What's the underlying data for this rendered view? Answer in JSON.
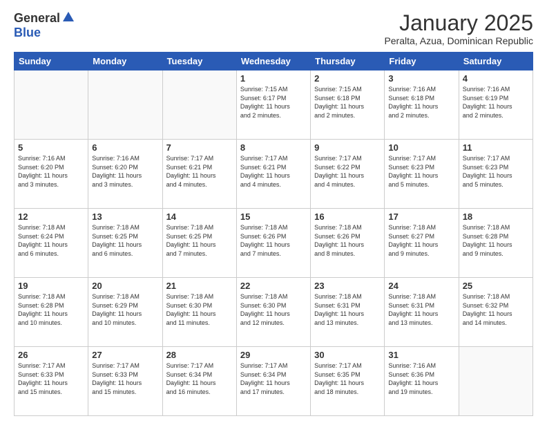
{
  "header": {
    "logo_general": "General",
    "logo_blue": "Blue",
    "title": "January 2025",
    "subtitle": "Peralta, Azua, Dominican Republic"
  },
  "weekdays": [
    "Sunday",
    "Monday",
    "Tuesday",
    "Wednesday",
    "Thursday",
    "Friday",
    "Saturday"
  ],
  "weeks": [
    [
      {
        "day": "",
        "info": ""
      },
      {
        "day": "",
        "info": ""
      },
      {
        "day": "",
        "info": ""
      },
      {
        "day": "1",
        "info": "Sunrise: 7:15 AM\nSunset: 6:17 PM\nDaylight: 11 hours\nand 2 minutes."
      },
      {
        "day": "2",
        "info": "Sunrise: 7:15 AM\nSunset: 6:18 PM\nDaylight: 11 hours\nand 2 minutes."
      },
      {
        "day": "3",
        "info": "Sunrise: 7:16 AM\nSunset: 6:18 PM\nDaylight: 11 hours\nand 2 minutes."
      },
      {
        "day": "4",
        "info": "Sunrise: 7:16 AM\nSunset: 6:19 PM\nDaylight: 11 hours\nand 2 minutes."
      }
    ],
    [
      {
        "day": "5",
        "info": "Sunrise: 7:16 AM\nSunset: 6:20 PM\nDaylight: 11 hours\nand 3 minutes."
      },
      {
        "day": "6",
        "info": "Sunrise: 7:16 AM\nSunset: 6:20 PM\nDaylight: 11 hours\nand 3 minutes."
      },
      {
        "day": "7",
        "info": "Sunrise: 7:17 AM\nSunset: 6:21 PM\nDaylight: 11 hours\nand 4 minutes."
      },
      {
        "day": "8",
        "info": "Sunrise: 7:17 AM\nSunset: 6:21 PM\nDaylight: 11 hours\nand 4 minutes."
      },
      {
        "day": "9",
        "info": "Sunrise: 7:17 AM\nSunset: 6:22 PM\nDaylight: 11 hours\nand 4 minutes."
      },
      {
        "day": "10",
        "info": "Sunrise: 7:17 AM\nSunset: 6:23 PM\nDaylight: 11 hours\nand 5 minutes."
      },
      {
        "day": "11",
        "info": "Sunrise: 7:17 AM\nSunset: 6:23 PM\nDaylight: 11 hours\nand 5 minutes."
      }
    ],
    [
      {
        "day": "12",
        "info": "Sunrise: 7:18 AM\nSunset: 6:24 PM\nDaylight: 11 hours\nand 6 minutes."
      },
      {
        "day": "13",
        "info": "Sunrise: 7:18 AM\nSunset: 6:25 PM\nDaylight: 11 hours\nand 6 minutes."
      },
      {
        "day": "14",
        "info": "Sunrise: 7:18 AM\nSunset: 6:25 PM\nDaylight: 11 hours\nand 7 minutes."
      },
      {
        "day": "15",
        "info": "Sunrise: 7:18 AM\nSunset: 6:26 PM\nDaylight: 11 hours\nand 7 minutes."
      },
      {
        "day": "16",
        "info": "Sunrise: 7:18 AM\nSunset: 6:26 PM\nDaylight: 11 hours\nand 8 minutes."
      },
      {
        "day": "17",
        "info": "Sunrise: 7:18 AM\nSunset: 6:27 PM\nDaylight: 11 hours\nand 9 minutes."
      },
      {
        "day": "18",
        "info": "Sunrise: 7:18 AM\nSunset: 6:28 PM\nDaylight: 11 hours\nand 9 minutes."
      }
    ],
    [
      {
        "day": "19",
        "info": "Sunrise: 7:18 AM\nSunset: 6:28 PM\nDaylight: 11 hours\nand 10 minutes."
      },
      {
        "day": "20",
        "info": "Sunrise: 7:18 AM\nSunset: 6:29 PM\nDaylight: 11 hours\nand 10 minutes."
      },
      {
        "day": "21",
        "info": "Sunrise: 7:18 AM\nSunset: 6:30 PM\nDaylight: 11 hours\nand 11 minutes."
      },
      {
        "day": "22",
        "info": "Sunrise: 7:18 AM\nSunset: 6:30 PM\nDaylight: 11 hours\nand 12 minutes."
      },
      {
        "day": "23",
        "info": "Sunrise: 7:18 AM\nSunset: 6:31 PM\nDaylight: 11 hours\nand 13 minutes."
      },
      {
        "day": "24",
        "info": "Sunrise: 7:18 AM\nSunset: 6:31 PM\nDaylight: 11 hours\nand 13 minutes."
      },
      {
        "day": "25",
        "info": "Sunrise: 7:18 AM\nSunset: 6:32 PM\nDaylight: 11 hours\nand 14 minutes."
      }
    ],
    [
      {
        "day": "26",
        "info": "Sunrise: 7:17 AM\nSunset: 6:33 PM\nDaylight: 11 hours\nand 15 minutes."
      },
      {
        "day": "27",
        "info": "Sunrise: 7:17 AM\nSunset: 6:33 PM\nDaylight: 11 hours\nand 15 minutes."
      },
      {
        "day": "28",
        "info": "Sunrise: 7:17 AM\nSunset: 6:34 PM\nDaylight: 11 hours\nand 16 minutes."
      },
      {
        "day": "29",
        "info": "Sunrise: 7:17 AM\nSunset: 6:34 PM\nDaylight: 11 hours\nand 17 minutes."
      },
      {
        "day": "30",
        "info": "Sunrise: 7:17 AM\nSunset: 6:35 PM\nDaylight: 11 hours\nand 18 minutes."
      },
      {
        "day": "31",
        "info": "Sunrise: 7:16 AM\nSunset: 6:36 PM\nDaylight: 11 hours\nand 19 minutes."
      },
      {
        "day": "",
        "info": ""
      }
    ]
  ]
}
